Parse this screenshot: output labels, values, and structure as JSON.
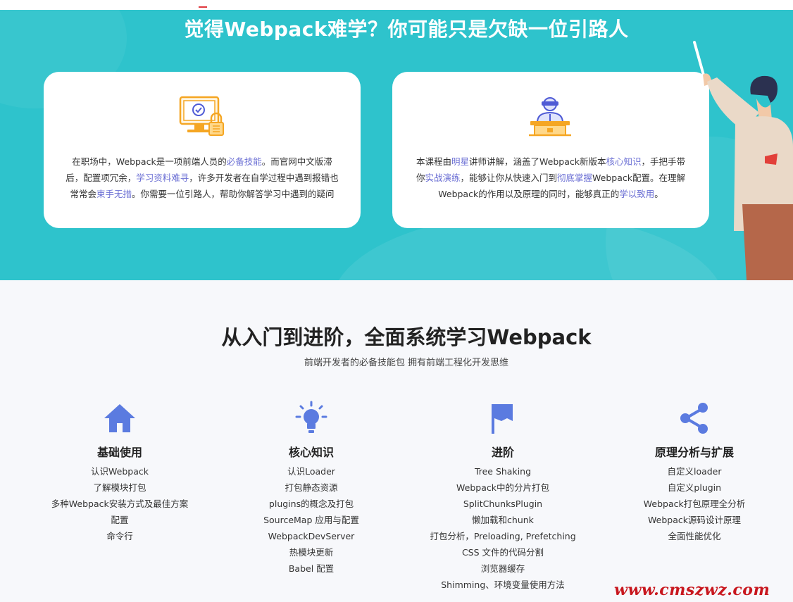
{
  "hero": {
    "title": "觉得Webpack难学？你可能只是欠缺一位引路人",
    "left_card": {
      "icon": "computer-lock-icon",
      "parts": [
        {
          "t": "在职场中，Webpack是一项前端人员的",
          "hl": false
        },
        {
          "t": "必备技能",
          "hl": true
        },
        {
          "t": "。而官网中文版滞后，配置项冗余，",
          "hl": false
        },
        {
          "t": "学习资料难寻",
          "hl": true
        },
        {
          "t": "，许多开发者在自学过程中遇到报错也常常会",
          "hl": false
        },
        {
          "t": "束手无措",
          "hl": true
        },
        {
          "t": "。你需要一位引路人，帮助你解答学习中遇到的疑问",
          "hl": false
        }
      ]
    },
    "right_card": {
      "icon": "lecturer-podium-icon",
      "parts": [
        {
          "t": "本课程由",
          "hl": false
        },
        {
          "t": "明星",
          "hl": true
        },
        {
          "t": "讲师讲解，涵盖了Webpack新版本",
          "hl": false
        },
        {
          "t": "核心知识",
          "hl": true
        },
        {
          "t": "，手把手带你",
          "hl": false
        },
        {
          "t": "实战演练",
          "hl": true
        },
        {
          "t": "，能够让你从快速入门到",
          "hl": false
        },
        {
          "t": "彻底掌握",
          "hl": true
        },
        {
          "t": "Webpack配置。在理解Webpack的作用以及原理的同时，能够真正的",
          "hl": false
        },
        {
          "t": "学以致用",
          "hl": true
        },
        {
          "t": "。",
          "hl": false
        }
      ]
    }
  },
  "section": {
    "title": "从入门到进阶，全面系统学习Webpack",
    "subtitle": "前端开发者的必备技能包 拥有前端工程化开发思维",
    "columns": [
      {
        "icon": "home-icon",
        "title": "基础使用",
        "items": [
          "认识Webpack",
          "了解模块打包",
          "多种Webpack安装方式及最佳方案",
          "配置",
          "命令行"
        ]
      },
      {
        "icon": "lightbulb-icon",
        "title": "核心知识",
        "items": [
          "认识Loader",
          "打包静态资源",
          "plugins的概念及打包",
          "SourceMap 应用与配置",
          "WebpackDevServer",
          "热模块更新",
          "Babel 配置"
        ]
      },
      {
        "icon": "flag-icon",
        "title": "进阶",
        "items": [
          "Tree Shaking",
          "Webpack中的分片打包",
          "SplitChunksPlugin",
          "懒加载和chunk",
          "打包分析，Preloading, Prefetching",
          "CSS 文件的代码分割",
          "浏览器缓存",
          "Shimming、环境变量使用方法"
        ]
      },
      {
        "icon": "share-icon",
        "title": "原理分析与扩展",
        "items": [
          "自定义loader",
          "自定义plugin",
          "Webpack打包原理全分析",
          "Webpack源码设计原理",
          "全面性能优化"
        ]
      }
    ]
  },
  "watermark": "www.cmszwz.com",
  "colors": {
    "hero_bg": "#2ec3cc",
    "highlight": "#6b6fd4",
    "icon_blue": "#5b7be0",
    "card_icon_orange": "#f5a623",
    "watermark_red": "#c8171e"
  }
}
